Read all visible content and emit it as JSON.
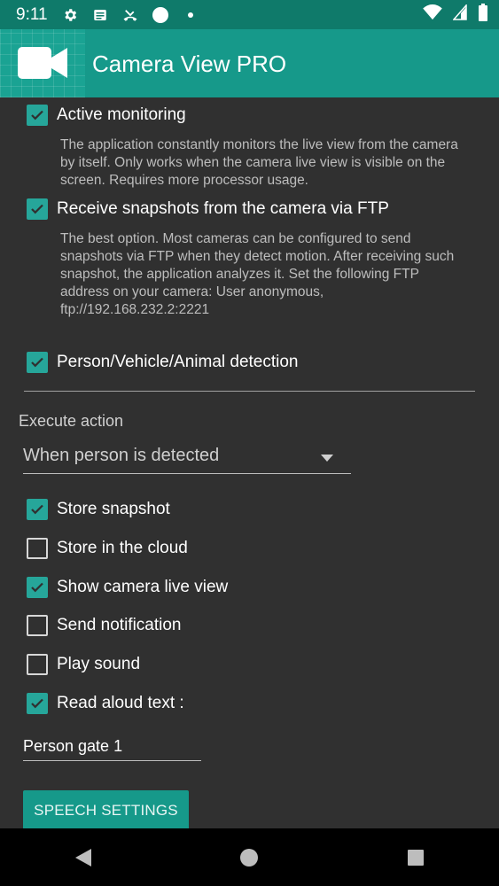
{
  "status_bar": {
    "time": "9:11",
    "icons": [
      "gear-icon",
      "news-icon",
      "missed-call-icon",
      "circle-icon",
      "dot-icon",
      "wifi-icon",
      "signal-icon",
      "battery-icon"
    ]
  },
  "app_bar": {
    "title": "Camera View PRO",
    "logo_icon": "video-camera-icon"
  },
  "detection": {
    "active_monitoring": {
      "label": "Active monitoring",
      "checked": true,
      "description": "The application constantly monitors the live view from the camera by itself. Only works when the camera live view is visible on the screen. Requires more processor usage."
    },
    "ftp_snapshots": {
      "label": "Receive snapshots from the camera via FTP",
      "checked": true,
      "description": "The best option. Most cameras can be configured to send snapshots via FTP when they detect motion. After receiving such snapshot, the application analyzes it. Set the following FTP address on your camera: User anonymous, ftp://192.168.232.2:2221"
    },
    "pva_detection": {
      "label": "Person/Vehicle/Animal detection",
      "checked": true
    }
  },
  "action": {
    "section_label": "Execute action",
    "selected": "When person is detected",
    "options": [
      {
        "label": "Store snapshot",
        "checked": true
      },
      {
        "label": "Store in the cloud",
        "checked": false
      },
      {
        "label": "Show camera live view",
        "checked": true
      },
      {
        "label": "Send notification",
        "checked": false
      },
      {
        "label": "Play sound",
        "checked": false
      },
      {
        "label": "Read aloud text :",
        "checked": true
      }
    ],
    "read_aloud_value": "Person gate 1",
    "speech_settings_label": "SPEECH SETTINGS"
  },
  "colors": {
    "accent": "#26a69a",
    "app_bar": "#16998a",
    "status_bar": "#0f7a6a",
    "background": "#303030"
  }
}
